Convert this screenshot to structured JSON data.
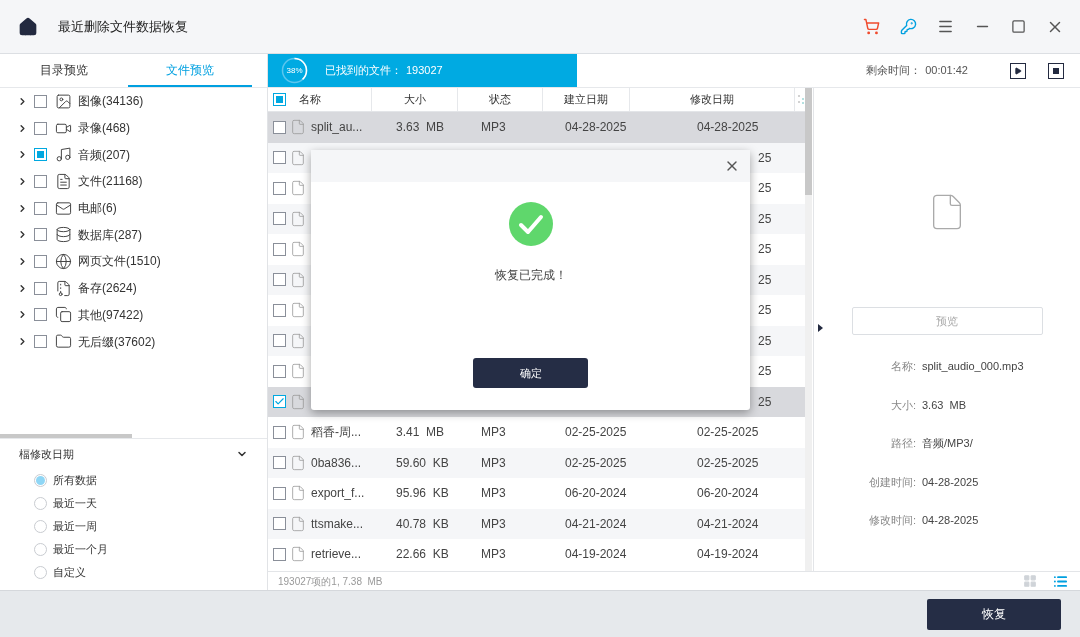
{
  "window": {
    "title": "最近删除文件数据恢复"
  },
  "sidebar": {
    "tabs": [
      {
        "label": "目录预览",
        "selected": false
      },
      {
        "label": "文件预览",
        "selected": true
      }
    ],
    "tree": [
      {
        "label": "图像(34136)",
        "expanded": false,
        "checked": false
      },
      {
        "label": "录像(468)",
        "expanded": false,
        "checked": false
      },
      {
        "label": "音频(207)",
        "expanded": false,
        "checked": true
      },
      {
        "label": "文件(21168)",
        "expanded": false,
        "checked": false
      },
      {
        "label": "电邮(6)",
        "expanded": false,
        "checked": false
      },
      {
        "label": "数据库(287)",
        "expanded": false,
        "checked": false
      },
      {
        "label": "网页文件(1510)",
        "expanded": false,
        "checked": false
      },
      {
        "label": "备存(2624)",
        "expanded": false,
        "checked": false
      },
      {
        "label": "其他(97422)",
        "expanded": false,
        "checked": false
      },
      {
        "label": "无后缀(37602)",
        "expanded": false,
        "checked": false
      }
    ],
    "filter": {
      "title": "楅修改日期",
      "expanded": true,
      "options": [
        {
          "label": "所有数据",
          "selected": true
        },
        {
          "label": "最近一天",
          "selected": false
        },
        {
          "label": "最近一周",
          "selected": false
        },
        {
          "label": "最近一个月",
          "selected": false
        },
        {
          "label": "自定义",
          "selected": false
        }
      ]
    }
  },
  "scan": {
    "percent": "38%",
    "level": 0.38,
    "found_label": "已找到的文件：",
    "found": "193027",
    "remaining_label": "剩余时间：",
    "remaining": "00:01:42"
  },
  "table": {
    "all_checked": true,
    "columns": [
      "名称",
      "大小",
      "状态",
      "建立日期",
      "修改日期"
    ],
    "rows": [
      {
        "kind": "full",
        "name": "split_au...",
        "size": "3.63  MB",
        "status": "MP3",
        "created": "04-28-2025",
        "modified": "04-28-2025",
        "selected": true,
        "checked": false
      },
      {
        "kind": "covered",
        "modified": "25",
        "selected": false,
        "checked": false
      },
      {
        "kind": "covered",
        "modified": "25",
        "selected": false,
        "checked": false
      },
      {
        "kind": "covered",
        "modified": "25",
        "selected": false,
        "checked": false
      },
      {
        "kind": "covered",
        "modified": "25",
        "selected": false,
        "checked": false
      },
      {
        "kind": "covered",
        "modified": "25",
        "selected": false,
        "checked": false
      },
      {
        "kind": "covered",
        "modified": "25",
        "selected": false,
        "checked": false
      },
      {
        "kind": "covered",
        "modified": "25",
        "selected": false,
        "checked": false
      },
      {
        "kind": "covered",
        "modified": "25",
        "selected": false,
        "checked": false
      },
      {
        "kind": "covered",
        "modified": "25",
        "selected": true,
        "checked": true
      },
      {
        "kind": "full",
        "name": "稻香-周...",
        "size": "3.41  MB",
        "status": "MP3",
        "created": "02-25-2025",
        "modified": "02-25-2025",
        "selected": false,
        "checked": false
      },
      {
        "kind": "full",
        "name": "0ba836...",
        "size": "59.60  KB",
        "status": "MP3",
        "created": "02-25-2025",
        "modified": "02-25-2025",
        "selected": false,
        "checked": false
      },
      {
        "kind": "full",
        "name": "export_f...",
        "size": "95.96  KB",
        "status": "MP3",
        "created": "06-20-2024",
        "modified": "06-20-2024",
        "selected": false,
        "checked": false
      },
      {
        "kind": "full",
        "name": "ttsmake...",
        "size": "40.78  KB",
        "status": "MP3",
        "created": "04-21-2024",
        "modified": "04-21-2024",
        "selected": false,
        "checked": false
      },
      {
        "kind": "full",
        "name": "retrieve...",
        "size": "22.66  KB",
        "status": "MP3",
        "created": "04-19-2024",
        "modified": "04-19-2024",
        "selected": false,
        "checked": false
      }
    ]
  },
  "details": {
    "preview_button": "预览",
    "preview_disabled": true,
    "fields": [
      {
        "label": "名称:",
        "value": "split_audio_000.mp3"
      },
      {
        "label": "大小:",
        "value": "3.63  MB"
      },
      {
        "label": "路径:",
        "value": "音频/MP3/"
      },
      {
        "label": "创建时间:",
        "value": "04-28-2025"
      },
      {
        "label": "修改时间:",
        "value": "04-28-2025"
      }
    ]
  },
  "status_bar": {
    "text": "193027项的1, 7.38  MB",
    "views": [
      {
        "kind": "grid",
        "selected": false
      },
      {
        "kind": "list",
        "selected": true
      }
    ]
  },
  "dialog": {
    "message": "恢复已完成！",
    "ok": "确定"
  },
  "footer": {
    "recover": "恢复"
  }
}
